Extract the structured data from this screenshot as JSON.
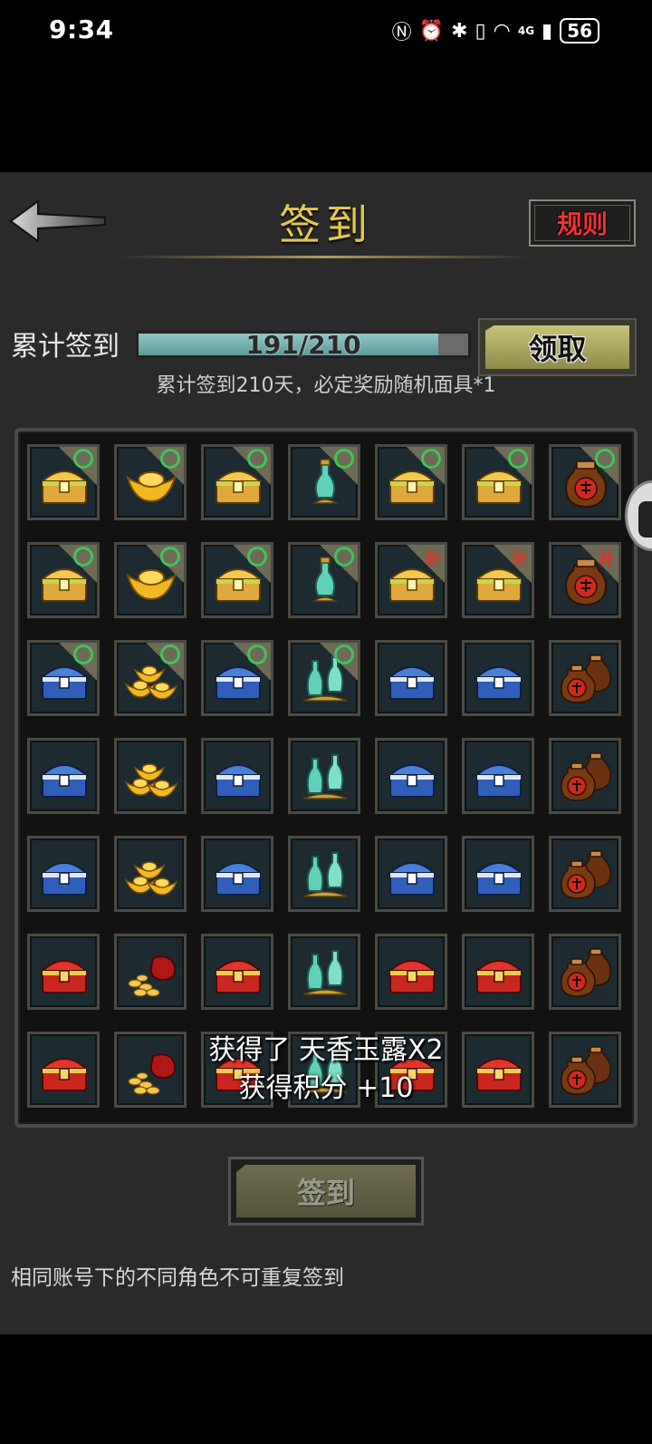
{
  "status_bar": {
    "time": "9:34",
    "network": "4G",
    "battery": "56"
  },
  "header": {
    "title": "签到",
    "rules_label": "规则"
  },
  "progress": {
    "label": "累计签到",
    "text": "191/210",
    "current": 191,
    "total": 210,
    "claim_label": "领取",
    "note": "累计签到210天，必定奖励随机面具*1"
  },
  "grid": {
    "rows": [
      [
        {
          "icon": "gold-chest-icon",
          "mark": "signed"
        },
        {
          "icon": "gold-ingot-icon",
          "mark": "signed"
        },
        {
          "icon": "gold-chest-icon",
          "mark": "signed"
        },
        {
          "icon": "jade-bottle-icon",
          "mark": "signed"
        },
        {
          "icon": "gold-chest-icon",
          "mark": "signed"
        },
        {
          "icon": "gold-chest-icon",
          "mark": "signed"
        },
        {
          "icon": "wine-jar-icon",
          "mark": "signed"
        }
      ],
      [
        {
          "icon": "gold-chest-icon",
          "mark": "signed"
        },
        {
          "icon": "gold-ingot-icon",
          "mark": "signed"
        },
        {
          "icon": "gold-chest-icon",
          "mark": "signed"
        },
        {
          "icon": "jade-bottle-icon",
          "mark": "signed"
        },
        {
          "icon": "gold-chest-icon",
          "mark": "makeup",
          "mark_text": "补"
        },
        {
          "icon": "gold-chest-icon",
          "mark": "makeup",
          "mark_text": "补"
        },
        {
          "icon": "wine-jar-icon",
          "mark": "makeup",
          "mark_text": "补"
        }
      ],
      [
        {
          "icon": "blue-chest-icon",
          "mark": "signed"
        },
        {
          "icon": "gold-ingots-icon",
          "mark": "signed"
        },
        {
          "icon": "blue-chest-icon",
          "mark": "signed"
        },
        {
          "icon": "jade-bottles-icon",
          "mark": "signed"
        },
        {
          "icon": "blue-chest-icon",
          "mark": "none"
        },
        {
          "icon": "blue-chest-icon",
          "mark": "none"
        },
        {
          "icon": "wine-jars-icon",
          "mark": "none"
        }
      ],
      [
        {
          "icon": "blue-chest-icon",
          "mark": "none"
        },
        {
          "icon": "gold-ingots-icon",
          "mark": "none"
        },
        {
          "icon": "blue-chest-icon",
          "mark": "none"
        },
        {
          "icon": "jade-bottles-icon",
          "mark": "none"
        },
        {
          "icon": "blue-chest-icon",
          "mark": "none"
        },
        {
          "icon": "blue-chest-icon",
          "mark": "none"
        },
        {
          "icon": "wine-jars-icon",
          "mark": "none"
        }
      ],
      [
        {
          "icon": "blue-chest-icon",
          "mark": "none"
        },
        {
          "icon": "gold-ingots-icon",
          "mark": "none"
        },
        {
          "icon": "blue-chest-icon",
          "mark": "none"
        },
        {
          "icon": "jade-bottles-icon",
          "mark": "none"
        },
        {
          "icon": "blue-chest-icon",
          "mark": "none"
        },
        {
          "icon": "blue-chest-icon",
          "mark": "none"
        },
        {
          "icon": "wine-jars-icon",
          "mark": "none"
        }
      ],
      [
        {
          "icon": "red-chest-icon",
          "mark": "none"
        },
        {
          "icon": "money-bag-icon",
          "mark": "none"
        },
        {
          "icon": "red-chest-icon",
          "mark": "none"
        },
        {
          "icon": "jade-bottles-icon",
          "mark": "none"
        },
        {
          "icon": "red-chest-icon",
          "mark": "none"
        },
        {
          "icon": "red-chest-icon",
          "mark": "none"
        },
        {
          "icon": "wine-jars-icon",
          "mark": "none"
        }
      ],
      [
        {
          "icon": "red-chest-icon",
          "mark": "none"
        },
        {
          "icon": "money-bag-icon",
          "mark": "none"
        },
        {
          "icon": "red-chest-icon",
          "mark": "none"
        },
        {
          "icon": "jade-bottles-icon",
          "mark": "none"
        },
        {
          "icon": "red-chest-icon",
          "mark": "none"
        },
        {
          "icon": "red-chest-icon",
          "mark": "none"
        },
        {
          "icon": "wine-jars-icon",
          "mark": "none"
        }
      ]
    ]
  },
  "toast": {
    "line1": "获得了 天香玉露X2",
    "line2": "获得积分 +10"
  },
  "sign_button": {
    "label": "签到"
  },
  "footer_note": "相同账号下的不同角色不可重复签到",
  "colors": {
    "title": "#e6c84a",
    "rules": "#e33333",
    "progress_fill": "#7ab3b3",
    "signed_ring": "#3fc35a",
    "makeup_mark": "#e0342a"
  }
}
